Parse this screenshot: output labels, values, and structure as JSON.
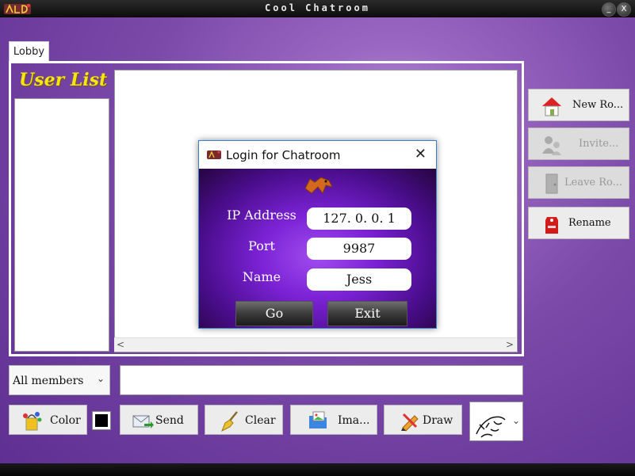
{
  "window": {
    "title": "Cool Chatroom",
    "minimize_glyph": "_",
    "close_glyph": "X"
  },
  "tab": {
    "label": "Lobby"
  },
  "user_list": {
    "title": "User List"
  },
  "side_buttons": [
    {
      "label": "New Ro...",
      "icon": "house-icon",
      "enabled": true
    },
    {
      "label": "Invite...",
      "icon": "users-icon",
      "enabled": false
    },
    {
      "label": "Leave Ro...",
      "icon": "door-icon",
      "enabled": false
    },
    {
      "label": "Rename",
      "icon": "tag-icon",
      "enabled": true
    }
  ],
  "composer": {
    "members_select": "All members",
    "message_value": ""
  },
  "toolbar": {
    "color_label": "Color",
    "send_label": "Send",
    "clear_label": "Clear",
    "image_label": "Ima...",
    "draw_label": "Draw",
    "current_color": "#000000"
  },
  "login_dialog": {
    "title": "Login for Chatroom",
    "close_glyph": "✕",
    "fields": [
      {
        "label": "IP Address",
        "value": "127. 0. 0. 1"
      },
      {
        "label": "Port",
        "value": "9987"
      },
      {
        "label": "Name",
        "value": "Jess"
      }
    ],
    "go_label": "Go",
    "exit_label": "Exit"
  },
  "colors": {
    "accent_yellow": "#f5e612",
    "dialog_purple": "#7a22d4",
    "background_purple": "#7c4aa9"
  }
}
